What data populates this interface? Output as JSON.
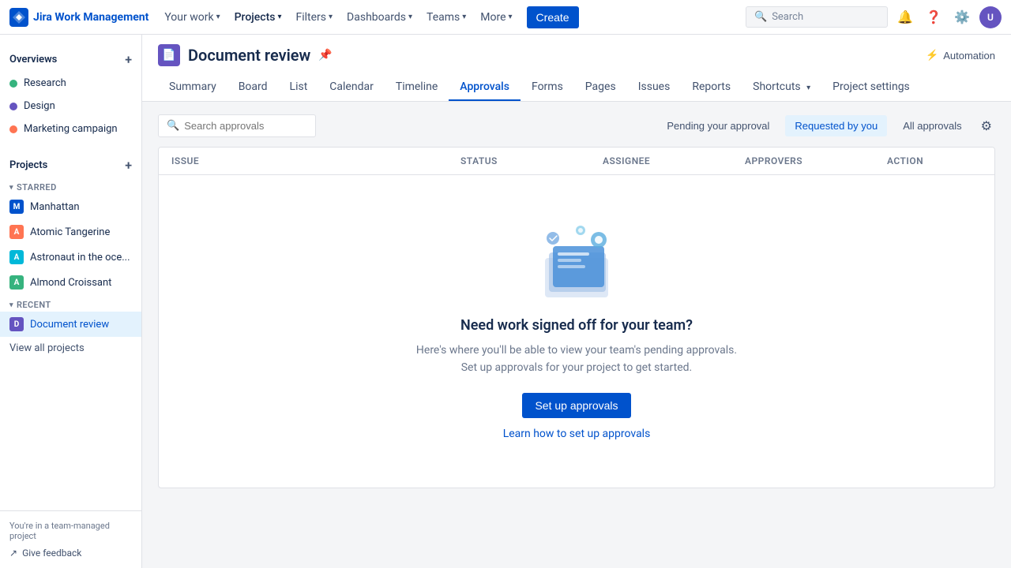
{
  "app": {
    "logo_text": "Jira Work Management",
    "logo_emoji": "⚡"
  },
  "topnav": {
    "items": [
      {
        "label": "Your work",
        "has_dropdown": true
      },
      {
        "label": "Projects",
        "has_dropdown": true,
        "active": true
      },
      {
        "label": "Filters",
        "has_dropdown": true
      },
      {
        "label": "Dashboards",
        "has_dropdown": true
      },
      {
        "label": "Teams",
        "has_dropdown": true
      },
      {
        "label": "More",
        "has_dropdown": true
      }
    ],
    "create_label": "Create",
    "search_placeholder": "Search",
    "avatar_initials": "U"
  },
  "sidebar": {
    "overviews_label": "Overviews",
    "overviews_items": [
      {
        "label": "Research",
        "color": "#36b37e"
      },
      {
        "label": "Design",
        "color": "#6554c0"
      },
      {
        "label": "Marketing campaign",
        "color": "#ff7452"
      }
    ],
    "projects_label": "Projects",
    "starred_label": "STARRED",
    "starred_items": [
      {
        "label": "Manhattan",
        "color": "#0052cc",
        "icon_text": "M"
      },
      {
        "label": "Atomic Tangerine",
        "color": "#ff7452",
        "icon_text": "A"
      },
      {
        "label": "Astronaut in the oce...",
        "color": "#00b8d9",
        "icon_text": "A"
      },
      {
        "label": "Almond Croissant",
        "color": "#36b37e",
        "icon_text": "A"
      }
    ],
    "recent_label": "RECENT",
    "recent_items": [
      {
        "label": "Document review",
        "color": "#6554c0",
        "icon_text": "D",
        "active": true
      }
    ],
    "view_all_label": "View all projects",
    "footer_text": "You're in a team-managed project",
    "feedback_label": "Give feedback"
  },
  "project": {
    "icon_emoji": "📄",
    "icon_bg": "#6554c0",
    "name": "Document review",
    "automation_label": "Automation",
    "tabs": [
      {
        "label": "Summary"
      },
      {
        "label": "Board"
      },
      {
        "label": "List"
      },
      {
        "label": "Calendar"
      },
      {
        "label": "Timeline"
      },
      {
        "label": "Approvals",
        "active": true
      },
      {
        "label": "Forms"
      },
      {
        "label": "Pages"
      },
      {
        "label": "Issues"
      },
      {
        "label": "Reports"
      },
      {
        "label": "Shortcuts",
        "has_dropdown": true
      },
      {
        "label": "Project settings"
      }
    ]
  },
  "approvals": {
    "search_placeholder": "Search approvals",
    "filter_tabs": [
      {
        "label": "Pending your approval"
      },
      {
        "label": "Requested by you",
        "active": true
      },
      {
        "label": "All approvals"
      }
    ],
    "table_columns": [
      "Issue",
      "Status",
      "Assignee",
      "Approvers",
      "Action"
    ],
    "empty_title": "Need work signed off for your team?",
    "empty_desc_line1": "Here's where you'll be able to view your team's pending approvals.",
    "empty_desc_line2": "Set up approvals for your project to get started.",
    "setup_button_label": "Set up approvals",
    "learn_link_label": "Learn how to set up approvals"
  }
}
